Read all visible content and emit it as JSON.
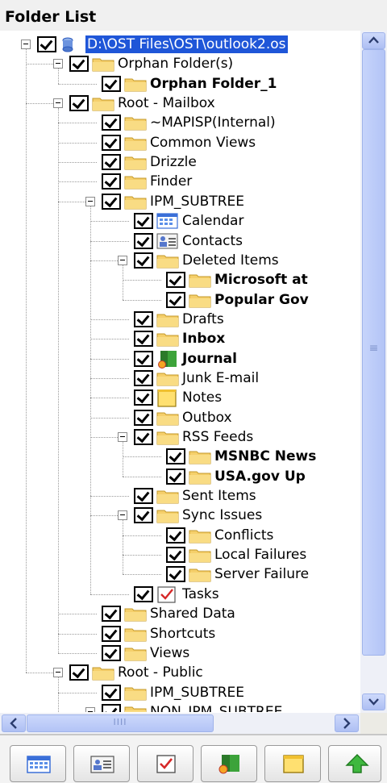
{
  "header": {
    "title": "Folder List"
  },
  "tree": [
    {
      "label": "D:\\OST Files\\OST\\outlook2.os",
      "depth": 0,
      "icon": "database-icon",
      "bold": false,
      "expander": true,
      "selected": true,
      "name": "root-ost-file"
    },
    {
      "label": "Orphan Folder(s)",
      "depth": 1,
      "icon": "folder-icon",
      "bold": false,
      "expander": true,
      "name": "orphan-folders"
    },
    {
      "label": "Orphan Folder_1",
      "depth": 2,
      "icon": "folder-icon",
      "bold": true,
      "expander": false,
      "name": "orphan-folder-1"
    },
    {
      "label": "Root - Mailbox",
      "depth": 1,
      "icon": "folder-icon",
      "bold": false,
      "expander": true,
      "name": "root-mailbox"
    },
    {
      "label": "~MAPISP(Internal)",
      "depth": 2,
      "icon": "folder-icon",
      "bold": false,
      "expander": false,
      "name": "mapisp-internal"
    },
    {
      "label": "Common Views",
      "depth": 2,
      "icon": "folder-icon",
      "bold": false,
      "expander": false,
      "name": "common-views"
    },
    {
      "label": "Drizzle",
      "depth": 2,
      "icon": "folder-icon",
      "bold": false,
      "expander": false,
      "name": "drizzle"
    },
    {
      "label": "Finder",
      "depth": 2,
      "icon": "folder-icon",
      "bold": false,
      "expander": false,
      "name": "finder"
    },
    {
      "label": "IPM_SUBTREE",
      "depth": 2,
      "icon": "folder-icon",
      "bold": false,
      "expander": true,
      "name": "ipm-subtree"
    },
    {
      "label": "Calendar",
      "depth": 3,
      "icon": "calendar-icon",
      "bold": false,
      "expander": false,
      "name": "calendar"
    },
    {
      "label": "Contacts",
      "depth": 3,
      "icon": "contacts-icon",
      "bold": false,
      "expander": false,
      "name": "contacts"
    },
    {
      "label": "Deleted Items",
      "depth": 3,
      "icon": "folder-icon",
      "bold": false,
      "expander": true,
      "name": "deleted-items"
    },
    {
      "label": "Microsoft at",
      "depth": 4,
      "icon": "folder-icon",
      "bold": true,
      "expander": false,
      "name": "microsoft-at"
    },
    {
      "label": "Popular Gov",
      "depth": 4,
      "icon": "folder-icon",
      "bold": true,
      "expander": false,
      "name": "popular-gov"
    },
    {
      "label": "Drafts",
      "depth": 3,
      "icon": "folder-icon",
      "bold": false,
      "expander": false,
      "name": "drafts"
    },
    {
      "label": "Inbox",
      "depth": 3,
      "icon": "folder-icon",
      "bold": true,
      "expander": false,
      "name": "inbox"
    },
    {
      "label": "Journal",
      "depth": 3,
      "icon": "journal-icon",
      "bold": true,
      "expander": false,
      "name": "journal"
    },
    {
      "label": "Junk E-mail",
      "depth": 3,
      "icon": "folder-icon",
      "bold": false,
      "expander": false,
      "name": "junk-email"
    },
    {
      "label": "Notes",
      "depth": 3,
      "icon": "notes-icon",
      "bold": false,
      "expander": false,
      "name": "notes"
    },
    {
      "label": "Outbox",
      "depth": 3,
      "icon": "folder-icon",
      "bold": false,
      "expander": false,
      "name": "outbox"
    },
    {
      "label": "RSS Feeds",
      "depth": 3,
      "icon": "folder-icon",
      "bold": false,
      "expander": true,
      "name": "rss-feeds"
    },
    {
      "label": "MSNBC News",
      "depth": 4,
      "icon": "folder-icon",
      "bold": true,
      "expander": false,
      "name": "msnbc-news"
    },
    {
      "label": "USA.gov Up",
      "depth": 4,
      "icon": "folder-icon",
      "bold": true,
      "expander": false,
      "name": "usa-gov-up"
    },
    {
      "label": "Sent Items",
      "depth": 3,
      "icon": "folder-icon",
      "bold": false,
      "expander": false,
      "name": "sent-items"
    },
    {
      "label": "Sync Issues",
      "depth": 3,
      "icon": "folder-icon",
      "bold": false,
      "expander": true,
      "name": "sync-issues"
    },
    {
      "label": "Conflicts",
      "depth": 4,
      "icon": "folder-icon",
      "bold": false,
      "expander": false,
      "name": "conflicts"
    },
    {
      "label": "Local Failures",
      "depth": 4,
      "icon": "folder-icon",
      "bold": false,
      "expander": false,
      "name": "local-failures"
    },
    {
      "label": "Server Failure",
      "depth": 4,
      "icon": "folder-icon",
      "bold": false,
      "expander": false,
      "name": "server-failures"
    },
    {
      "label": "Tasks",
      "depth": 3,
      "icon": "tasks-icon",
      "bold": false,
      "expander": false,
      "name": "tasks"
    },
    {
      "label": "Shared Data",
      "depth": 2,
      "icon": "folder-icon",
      "bold": false,
      "expander": false,
      "name": "shared-data"
    },
    {
      "label": "Shortcuts",
      "depth": 2,
      "icon": "folder-icon",
      "bold": false,
      "expander": false,
      "name": "shortcuts"
    },
    {
      "label": "Views",
      "depth": 2,
      "icon": "folder-icon",
      "bold": false,
      "expander": false,
      "name": "views"
    },
    {
      "label": "Root - Public",
      "depth": 1,
      "icon": "folder-icon",
      "bold": false,
      "expander": true,
      "name": "root-public"
    },
    {
      "label": "IPM_SUBTREE",
      "depth": 2,
      "icon": "folder-icon",
      "bold": false,
      "expander": false,
      "name": "public-ipm-subtree"
    },
    {
      "label": "NON_IPM_SUBTREE",
      "depth": 2,
      "icon": "folder-icon",
      "bold": false,
      "expander": true,
      "name": "non-ipm-subtree"
    }
  ],
  "scrollbar": {
    "h_grip": "IIII",
    "v_grip": "≡"
  },
  "bottom_nav": [
    {
      "icon": "calendar-icon",
      "label": "Calendar"
    },
    {
      "icon": "contacts-icon",
      "label": "Contacts"
    },
    {
      "icon": "tasks-icon",
      "label": "Tasks"
    },
    {
      "icon": "journal-icon",
      "label": "Journal"
    },
    {
      "icon": "notes-icon",
      "label": "Notes"
    },
    {
      "icon": "arrow-up-icon",
      "label": "Up"
    }
  ],
  "colors": {
    "selection": "#1f56d8",
    "folder": "#f5cf6b",
    "scroll": "#b8c9f7"
  }
}
